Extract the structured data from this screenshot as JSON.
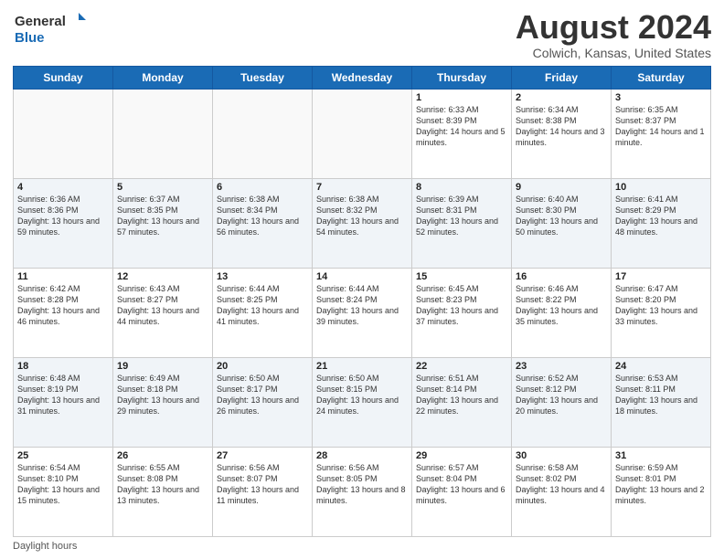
{
  "logo": {
    "text1": "General",
    "text2": "Blue"
  },
  "title": "August 2024",
  "location": "Colwich, Kansas, United States",
  "days_of_week": [
    "Sunday",
    "Monday",
    "Tuesday",
    "Wednesday",
    "Thursday",
    "Friday",
    "Saturday"
  ],
  "footer": "Daylight hours",
  "weeks": [
    [
      {
        "day": "",
        "empty": true
      },
      {
        "day": "",
        "empty": true
      },
      {
        "day": "",
        "empty": true
      },
      {
        "day": "",
        "empty": true
      },
      {
        "day": "1",
        "sunrise": "Sunrise: 6:33 AM",
        "sunset": "Sunset: 8:39 PM",
        "daylight": "Daylight: 14 hours and 5 minutes."
      },
      {
        "day": "2",
        "sunrise": "Sunrise: 6:34 AM",
        "sunset": "Sunset: 8:38 PM",
        "daylight": "Daylight: 14 hours and 3 minutes."
      },
      {
        "day": "3",
        "sunrise": "Sunrise: 6:35 AM",
        "sunset": "Sunset: 8:37 PM",
        "daylight": "Daylight: 14 hours and 1 minute."
      }
    ],
    [
      {
        "day": "4",
        "sunrise": "Sunrise: 6:36 AM",
        "sunset": "Sunset: 8:36 PM",
        "daylight": "Daylight: 13 hours and 59 minutes."
      },
      {
        "day": "5",
        "sunrise": "Sunrise: 6:37 AM",
        "sunset": "Sunset: 8:35 PM",
        "daylight": "Daylight: 13 hours and 57 minutes."
      },
      {
        "day": "6",
        "sunrise": "Sunrise: 6:38 AM",
        "sunset": "Sunset: 8:34 PM",
        "daylight": "Daylight: 13 hours and 56 minutes."
      },
      {
        "day": "7",
        "sunrise": "Sunrise: 6:38 AM",
        "sunset": "Sunset: 8:32 PM",
        "daylight": "Daylight: 13 hours and 54 minutes."
      },
      {
        "day": "8",
        "sunrise": "Sunrise: 6:39 AM",
        "sunset": "Sunset: 8:31 PM",
        "daylight": "Daylight: 13 hours and 52 minutes."
      },
      {
        "day": "9",
        "sunrise": "Sunrise: 6:40 AM",
        "sunset": "Sunset: 8:30 PM",
        "daylight": "Daylight: 13 hours and 50 minutes."
      },
      {
        "day": "10",
        "sunrise": "Sunrise: 6:41 AM",
        "sunset": "Sunset: 8:29 PM",
        "daylight": "Daylight: 13 hours and 48 minutes."
      }
    ],
    [
      {
        "day": "11",
        "sunrise": "Sunrise: 6:42 AM",
        "sunset": "Sunset: 8:28 PM",
        "daylight": "Daylight: 13 hours and 46 minutes."
      },
      {
        "day": "12",
        "sunrise": "Sunrise: 6:43 AM",
        "sunset": "Sunset: 8:27 PM",
        "daylight": "Daylight: 13 hours and 44 minutes."
      },
      {
        "day": "13",
        "sunrise": "Sunrise: 6:44 AM",
        "sunset": "Sunset: 8:25 PM",
        "daylight": "Daylight: 13 hours and 41 minutes."
      },
      {
        "day": "14",
        "sunrise": "Sunrise: 6:44 AM",
        "sunset": "Sunset: 8:24 PM",
        "daylight": "Daylight: 13 hours and 39 minutes."
      },
      {
        "day": "15",
        "sunrise": "Sunrise: 6:45 AM",
        "sunset": "Sunset: 8:23 PM",
        "daylight": "Daylight: 13 hours and 37 minutes."
      },
      {
        "day": "16",
        "sunrise": "Sunrise: 6:46 AM",
        "sunset": "Sunset: 8:22 PM",
        "daylight": "Daylight: 13 hours and 35 minutes."
      },
      {
        "day": "17",
        "sunrise": "Sunrise: 6:47 AM",
        "sunset": "Sunset: 8:20 PM",
        "daylight": "Daylight: 13 hours and 33 minutes."
      }
    ],
    [
      {
        "day": "18",
        "sunrise": "Sunrise: 6:48 AM",
        "sunset": "Sunset: 8:19 PM",
        "daylight": "Daylight: 13 hours and 31 minutes."
      },
      {
        "day": "19",
        "sunrise": "Sunrise: 6:49 AM",
        "sunset": "Sunset: 8:18 PM",
        "daylight": "Daylight: 13 hours and 29 minutes."
      },
      {
        "day": "20",
        "sunrise": "Sunrise: 6:50 AM",
        "sunset": "Sunset: 8:17 PM",
        "daylight": "Daylight: 13 hours and 26 minutes."
      },
      {
        "day": "21",
        "sunrise": "Sunrise: 6:50 AM",
        "sunset": "Sunset: 8:15 PM",
        "daylight": "Daylight: 13 hours and 24 minutes."
      },
      {
        "day": "22",
        "sunrise": "Sunrise: 6:51 AM",
        "sunset": "Sunset: 8:14 PM",
        "daylight": "Daylight: 13 hours and 22 minutes."
      },
      {
        "day": "23",
        "sunrise": "Sunrise: 6:52 AM",
        "sunset": "Sunset: 8:12 PM",
        "daylight": "Daylight: 13 hours and 20 minutes."
      },
      {
        "day": "24",
        "sunrise": "Sunrise: 6:53 AM",
        "sunset": "Sunset: 8:11 PM",
        "daylight": "Daylight: 13 hours and 18 minutes."
      }
    ],
    [
      {
        "day": "25",
        "sunrise": "Sunrise: 6:54 AM",
        "sunset": "Sunset: 8:10 PM",
        "daylight": "Daylight: 13 hours and 15 minutes."
      },
      {
        "day": "26",
        "sunrise": "Sunrise: 6:55 AM",
        "sunset": "Sunset: 8:08 PM",
        "daylight": "Daylight: 13 hours and 13 minutes."
      },
      {
        "day": "27",
        "sunrise": "Sunrise: 6:56 AM",
        "sunset": "Sunset: 8:07 PM",
        "daylight": "Daylight: 13 hours and 11 minutes."
      },
      {
        "day": "28",
        "sunrise": "Sunrise: 6:56 AM",
        "sunset": "Sunset: 8:05 PM",
        "daylight": "Daylight: 13 hours and 8 minutes."
      },
      {
        "day": "29",
        "sunrise": "Sunrise: 6:57 AM",
        "sunset": "Sunset: 8:04 PM",
        "daylight": "Daylight: 13 hours and 6 minutes."
      },
      {
        "day": "30",
        "sunrise": "Sunrise: 6:58 AM",
        "sunset": "Sunset: 8:02 PM",
        "daylight": "Daylight: 13 hours and 4 minutes."
      },
      {
        "day": "31",
        "sunrise": "Sunrise: 6:59 AM",
        "sunset": "Sunset: 8:01 PM",
        "daylight": "Daylight: 13 hours and 2 minutes."
      }
    ]
  ]
}
